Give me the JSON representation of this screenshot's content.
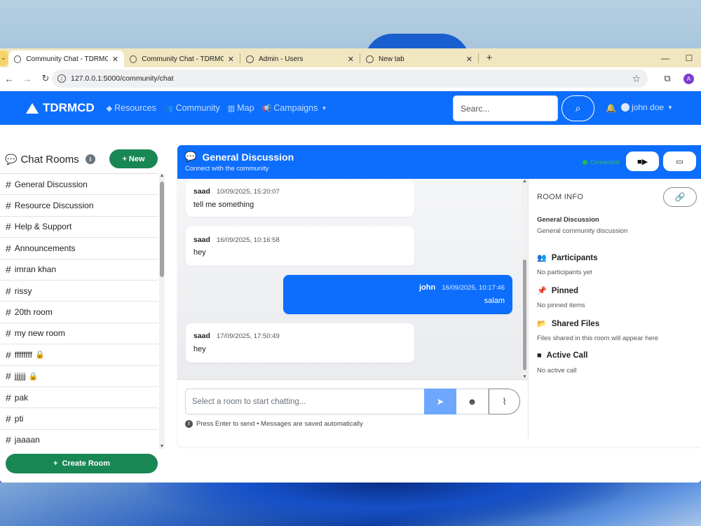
{
  "browser": {
    "tabs": [
      {
        "title": "Community Chat - TDRMCD",
        "active": true
      },
      {
        "title": "Community Chat - TDRMCD",
        "active": false
      },
      {
        "title": "Admin - Users",
        "active": false
      },
      {
        "title": "New tab",
        "active": false
      }
    ],
    "url": "127.0.0.1:5000/community/chat",
    "profile_initial": "A"
  },
  "navbar": {
    "brand": "TDRMCD",
    "links": [
      {
        "label": "Resources",
        "icon": "gem-icon"
      },
      {
        "label": "Community",
        "icon": "users-icon"
      },
      {
        "label": "Map",
        "icon": "map-icon"
      },
      {
        "label": "Campaigns",
        "icon": "bullhorn-icon"
      }
    ],
    "search_placeholder": "Search...",
    "search_display": "Searc...",
    "user_name": "john doe"
  },
  "sidebar": {
    "title": "Chat Rooms",
    "new_label": "New",
    "rooms": [
      {
        "name": "General Discussion",
        "locked": false
      },
      {
        "name": "Resource Discussion",
        "locked": false
      },
      {
        "name": "Help & Support",
        "locked": false
      },
      {
        "name": "Announcements",
        "locked": false
      },
      {
        "name": "imran khan",
        "locked": false
      },
      {
        "name": "rissy",
        "locked": false
      },
      {
        "name": "20th room",
        "locked": false
      },
      {
        "name": "my new room",
        "locked": false
      },
      {
        "name": "ffffffff",
        "locked": true
      },
      {
        "name": "jjjjjj",
        "locked": true
      },
      {
        "name": "pak",
        "locked": false
      },
      {
        "name": "pti",
        "locked": false
      },
      {
        "name": "jaaaan",
        "locked": false
      }
    ],
    "create_label": "Create Room"
  },
  "chat": {
    "title": "General Discussion",
    "subtitle": "Connect with the community",
    "status": "Connected",
    "messages": [
      {
        "author": "saad",
        "time": "10/09/2025, 15:20:07",
        "text": "tell me something",
        "own": false
      },
      {
        "author": "saad",
        "time": "16/09/2025, 10:16:58",
        "text": "hey",
        "own": false
      },
      {
        "author": "john",
        "time": "16/09/2025, 10:17:46",
        "text": "salam",
        "own": true
      },
      {
        "author": "saad",
        "time": "17/09/2025, 17:50:49",
        "text": "hey",
        "own": false
      }
    ],
    "input_placeholder": "Select a room to start chatting...",
    "hint": "Press Enter to send • Messages are saved automatically"
  },
  "room_info": {
    "title": "ROOM INFO",
    "name": "General Discussion",
    "description": "General community discussion",
    "sections": [
      {
        "label": "Participants",
        "icon": "users-icon",
        "value": "No participants yet"
      },
      {
        "label": "Pinned",
        "icon": "thumbtack-icon",
        "value": "No pinned items"
      },
      {
        "label": "Shared Files",
        "icon": "folder-open-icon",
        "value": "Files shared in this room will appear here"
      },
      {
        "label": "Active Call",
        "icon": "video-icon",
        "value": "No active call"
      }
    ]
  },
  "colors": {
    "primary": "#0d6efd",
    "success": "#198754",
    "connected": "#22bb55"
  }
}
